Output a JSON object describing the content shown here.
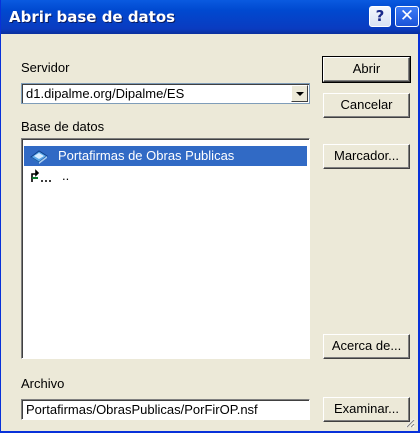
{
  "window": {
    "title": "Abrir base de datos",
    "help_glyph": "?",
    "close_glyph": "✕"
  },
  "server": {
    "label": "Servidor",
    "selected": "d1.dipalme.org/Dipalme/ES"
  },
  "database": {
    "label": "Base de datos",
    "items": [
      {
        "text": "Portafirmas de Obras Publicas",
        "icon": "database-icon",
        "selected": true
      },
      {
        "text": "..",
        "icon": "folder-up-icon",
        "selected": false
      }
    ]
  },
  "file": {
    "label": "Archivo",
    "value": "Portafirmas/ObrasPublicas/PorFirOP.nsf"
  },
  "buttons": {
    "open": "Abrir",
    "cancel": "Cancelar",
    "bookmark": "Marcador...",
    "about": "Acerca de...",
    "browse": "Examinar..."
  },
  "colors": {
    "titlebar": "#0a3bc0",
    "selection": "#316ac5",
    "dialog_bg": "#ece9d8"
  }
}
